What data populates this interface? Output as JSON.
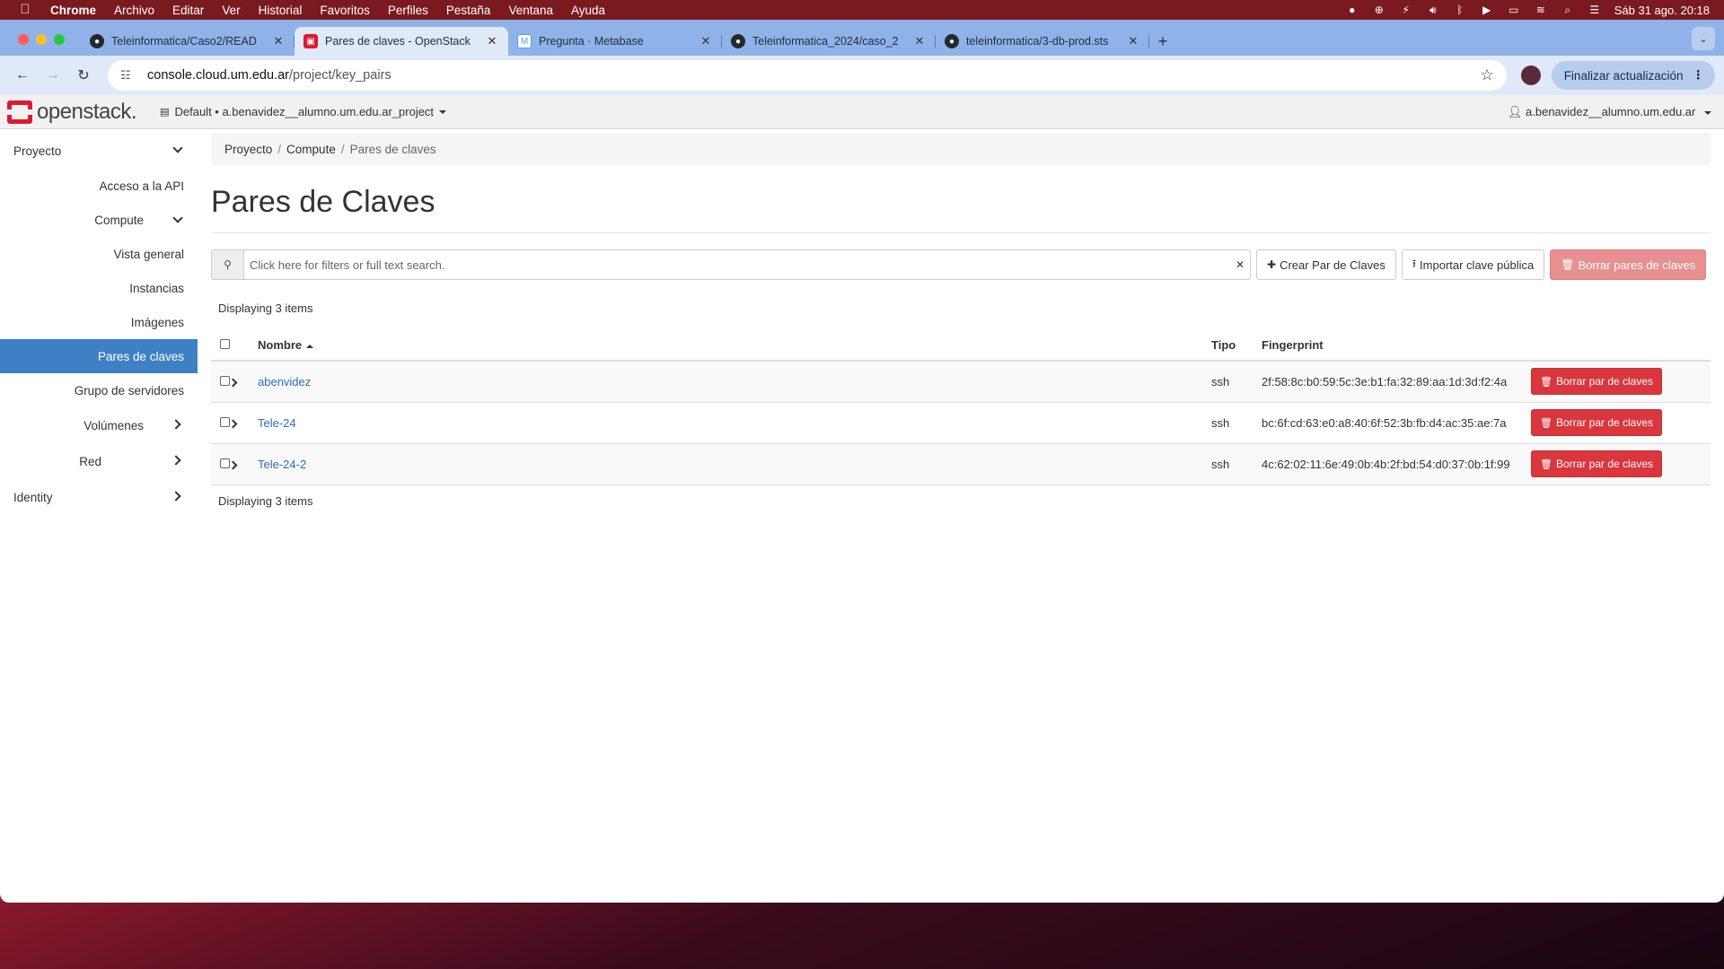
{
  "menubar": {
    "app": "Chrome",
    "items": [
      "Archivo",
      "Editar",
      "Ver",
      "Historial",
      "Favoritos",
      "Perfiles",
      "Pestaña",
      "Ventana",
      "Ayuda"
    ],
    "datetime": "Sáb 31 ago.  20:18"
  },
  "tabs": [
    {
      "title": "Teleinformatica/Caso2/READ",
      "favicon": "github-icon"
    },
    {
      "title": "Pares de claves - OpenStack",
      "favicon": "openstack-icon"
    },
    {
      "title": "Pregunta · Metabase",
      "favicon": "metabase-icon"
    },
    {
      "title": "Teleinformatica_2024/caso_2",
      "favicon": "github-icon"
    },
    {
      "title": "teleinformatica/3-db-prod.sts",
      "favicon": "github-icon"
    }
  ],
  "address": {
    "host": "console.cloud.um.edu.ar",
    "path": "/project/key_pairs"
  },
  "update_button": "Finalizar actualización",
  "header": {
    "logo": "openstack.",
    "project_selector": "Default • a.benavidez__alumno.um.edu.ar_project",
    "user": "a.benavidez__alumno.um.edu.ar"
  },
  "sidebar": {
    "proyecto": "Proyecto",
    "acceso_api": "Acceso a la API",
    "compute": "Compute",
    "vista_general": "Vista general",
    "instancias": "Instancias",
    "imagenes": "Imágenes",
    "pares_claves": "Pares de claves",
    "grupo_servidores": "Grupo de servidores",
    "volumenes": "Volúmenes",
    "red": "Red",
    "identity": "Identity"
  },
  "breadcrumb": {
    "b1": "Proyecto",
    "b2": "Compute",
    "b3": "Pares de claves"
  },
  "page_title": "Pares de Claves",
  "search": {
    "placeholder": "Click here for filters or full text search."
  },
  "buttons": {
    "crear": "Crear Par de Claves",
    "importar": "Importar clave pública",
    "borrar_todos": "Borrar pares de claves",
    "borrar_fila": "Borrar par de claves"
  },
  "displaying": "Displaying 3 items",
  "table": {
    "columns": {
      "nombre": "Nombre",
      "tipo": "Tipo",
      "fingerprint": "Fingerprint"
    },
    "rows": [
      {
        "nombre": "abenvidez",
        "tipo": "ssh",
        "fingerprint": "2f:58:8c:b0:59:5c:3e:b1:fa:32:89:aa:1d:3d:f2:4a"
      },
      {
        "nombre": "Tele-24",
        "tipo": "ssh",
        "fingerprint": "bc:6f:cd:63:e0:a8:40:6f:52:3b:fb:d4:ac:35:ae:7a"
      },
      {
        "nombre": "Tele-24-2",
        "tipo": "ssh",
        "fingerprint": "4c:62:02:11:6e:49:0b:4b:2f:bd:54:d0:37:0b:1f:99"
      }
    ]
  },
  "colors": {
    "accent": "#3e80c5",
    "danger": "#d9363e",
    "brand": "#da1a32"
  }
}
